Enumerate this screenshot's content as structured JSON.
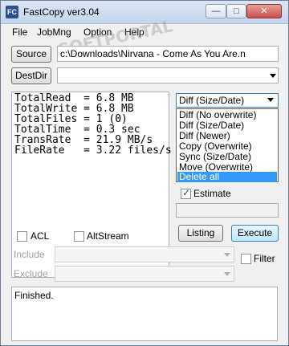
{
  "window": {
    "icon_text": "FC",
    "title": "FastCopy ver3.04",
    "controls": {
      "minimize": "—",
      "maximize": "□",
      "close": "✕"
    }
  },
  "menu": [
    "File",
    "JobMng",
    "Option",
    "Help"
  ],
  "source": {
    "button_label": "Source",
    "path": "c:\\Downloads\\Nirvana - Come As You Are.n"
  },
  "destdir": {
    "button_label": "DestDir",
    "path": ""
  },
  "stats": [
    "TotalRead  = 6.8 MB",
    "TotalWrite = 6.8 MB",
    "TotalFiles = 1 (0)",
    "TotalTime  = 0.3 sec",
    "TransRate  = 21.9 MB/s",
    "FileRate   = 3.22 files/s"
  ],
  "mode": {
    "selected": "Diff (Size/Date)",
    "options": [
      "Diff (No overwrite)",
      "Diff (Size/Date)",
      "Diff (Newer)",
      "Copy (Overwrite)",
      "Sync (Size/Date)",
      "Move (Overwrite)",
      "Delete all"
    ],
    "highlighted": "Delete all"
  },
  "estimate": {
    "label": "Estimate",
    "checked": true
  },
  "buttons": {
    "listing": "Listing",
    "execute": "Execute"
  },
  "acl": {
    "label": "ACL",
    "checked": false
  },
  "altstream": {
    "label": "AltStream",
    "checked": false
  },
  "include": {
    "label": "Include"
  },
  "exclude": {
    "label": "Exclude"
  },
  "filter": {
    "label": "Filter",
    "checked": false
  },
  "status_text": "Finished.",
  "watermark": "SOFTPORTAL"
}
